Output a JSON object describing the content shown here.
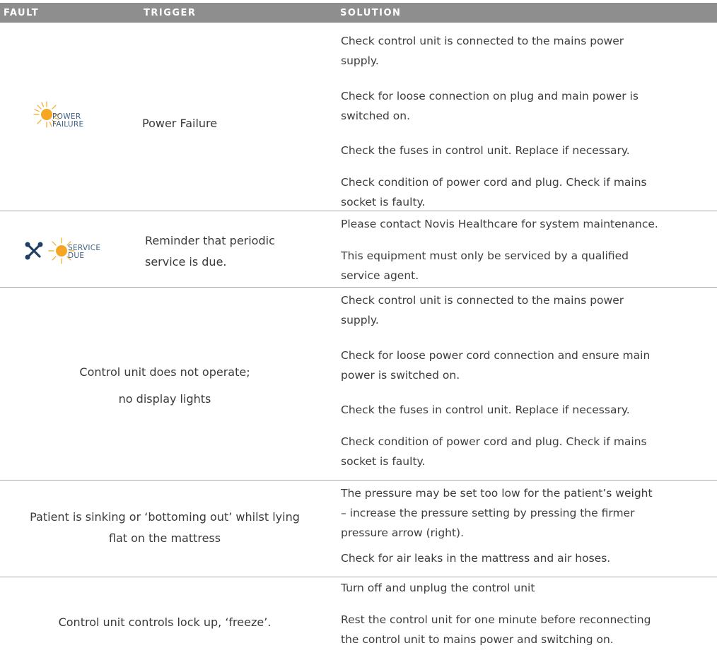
{
  "header": {
    "fault": "FAULT",
    "trigger": "TRIGGER",
    "solution": "SOLUTION"
  },
  "rows": [
    {
      "icon_label": [
        "POWER",
        "FAILURE"
      ],
      "trigger": "Power Failure",
      "solutions": [
        [
          "Check control unit is connected to the mains power",
          "supply."
        ],
        [
          "Check for loose connection on plug and main power is",
          "switched on."
        ],
        [
          "Check the fuses in control unit. Replace if necessary."
        ],
        [
          "Check condition of power cord and plug. Check if mains",
          "socket is faulty."
        ]
      ]
    },
    {
      "icon_label": [
        "SERVICE",
        "DUE"
      ],
      "trigger": [
        "Reminder that periodic",
        "service is due."
      ],
      "solutions": [
        [
          "Please contact Novis Healthcare for system maintenance."
        ],
        [
          "This equipment must only be serviced by a qualified",
          "service agent."
        ]
      ]
    },
    {
      "trigger": [
        "Control unit does not operate;",
        "no display lights"
      ],
      "solutions": [
        [
          "Check control unit is connected to the mains power",
          "supply."
        ],
        [
          "Check for loose power cord connection and ensure main",
          "power is switched on."
        ],
        [
          "Check the fuses in control unit. Replace if necessary."
        ],
        [
          "Check condition of power cord and plug. Check if mains",
          "socket is faulty."
        ]
      ]
    },
    {
      "trigger": [
        "Patient is sinking or ‘bottoming out’ whilst lying",
        "flat on the mattress"
      ],
      "solutions": [
        [
          "The pressure may be set too low for the patient’s weight",
          "– increase the pressure setting by pressing the firmer",
          "pressure arrow (right)."
        ],
        [
          "Check for air leaks in the mattress and air hoses."
        ]
      ]
    },
    {
      "trigger": "Control unit controls lock up, ‘freeze’.",
      "solutions": [
        [
          "Turn off and unplug the control unit"
        ],
        [
          "Rest the control unit for one minute before reconnecting",
          "the control unit to mains power and switching on."
        ]
      ]
    }
  ],
  "colors": {
    "header_bg": "#8e8e8e",
    "sun": "#f5a623",
    "icon_text": "#3c5f84",
    "tool_icon": "#1f3f66"
  }
}
